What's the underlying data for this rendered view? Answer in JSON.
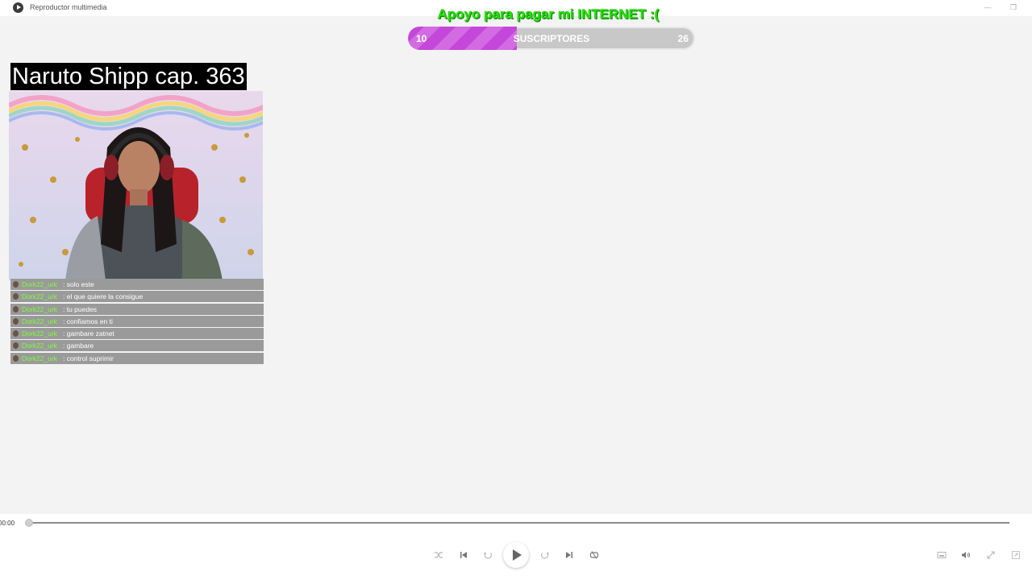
{
  "window": {
    "title": "Reproductor multimedia",
    "minimize_glyph": "—",
    "restore_glyph": "❐"
  },
  "overlay": {
    "goal_title": "Apoyo para pagar mi INTERNET :(",
    "goal_start": "10",
    "goal_label": "SUSCRIPTORES",
    "goal_end": "26",
    "goal_progress": 0.38,
    "goal_fill_color": "#c347d8",
    "title_color": "#22e000"
  },
  "stream": {
    "title": "Naruto Shipp cap. 363"
  },
  "chat": {
    "messages": [
      {
        "user": "Dork22_urk",
        "text": ": solo este"
      },
      {
        "user": "Dork22_urk",
        "text": ": el que quiere la consigue"
      },
      {
        "user": "Dork22_urk",
        "text": ": tu puedes"
      },
      {
        "user": "Dork22_urk",
        "text": ": confiamos en ti"
      },
      {
        "user": "Dork22_urk",
        "text": ": gambare zatnet"
      },
      {
        "user": "Dork22_urk",
        "text": ": gambare"
      },
      {
        "user": "Dork22_urk",
        "text": ": control suprimir"
      }
    ]
  },
  "player": {
    "elapsed": "00:00",
    "position_fraction": 0.0,
    "icons": [
      "shuffle-icon",
      "previous-icon",
      "rewind-10-icon",
      "play-icon",
      "forward-30-icon",
      "next-icon",
      "repeat-icon",
      "miniplayer-icon",
      "volume-icon",
      "fullscreen-icon",
      "overlay-icon"
    ]
  }
}
